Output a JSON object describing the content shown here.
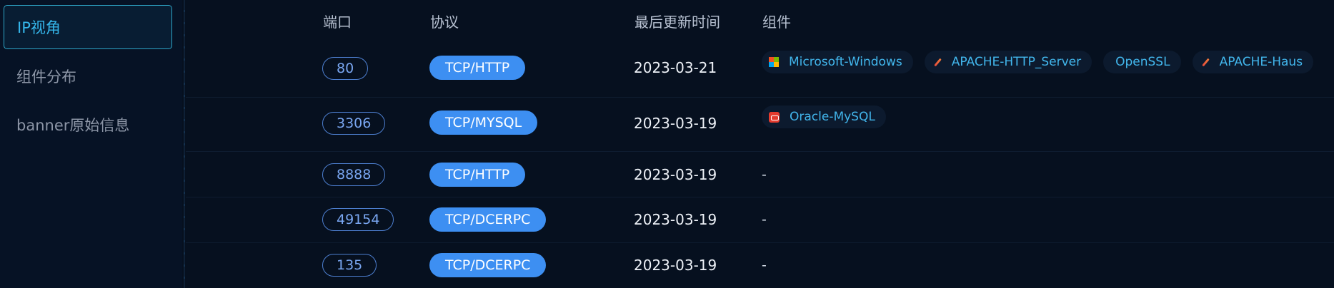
{
  "sidebar": {
    "items": [
      {
        "label": "IP视角",
        "active": true
      },
      {
        "label": "组件分布",
        "active": false
      },
      {
        "label": "banner原始信息",
        "active": false
      }
    ]
  },
  "table": {
    "headers": {
      "port": "端口",
      "protocol": "协议",
      "updated": "最后更新时间",
      "components": "组件"
    },
    "rows": [
      {
        "port": "80",
        "protocol": "TCP/HTTP",
        "updated": "2023-03-21",
        "components": [
          {
            "label": "Microsoft-Windows",
            "icon": "windows-icon"
          },
          {
            "label": "APACHE-HTTP_Server",
            "icon": "apache-feather-icon"
          },
          {
            "label": "OpenSSL",
            "icon": ""
          },
          {
            "label": "APACHE-Haus",
            "icon": "apache-feather-icon"
          }
        ],
        "empty": ""
      },
      {
        "port": "3306",
        "protocol": "TCP/MYSQL",
        "updated": "2023-03-19",
        "components": [
          {
            "label": "Oracle-MySQL",
            "icon": "mysql-icon"
          }
        ],
        "empty": ""
      },
      {
        "port": "8888",
        "protocol": "TCP/HTTP",
        "updated": "2023-03-19",
        "components": [],
        "empty": "-"
      },
      {
        "port": "49154",
        "protocol": "TCP/DCERPC",
        "updated": "2023-03-19",
        "components": [],
        "empty": "-"
      },
      {
        "port": "135",
        "protocol": "TCP/DCERPC",
        "updated": "2023-03-19",
        "components": [],
        "empty": "-"
      }
    ]
  },
  "colors": {
    "background": "#06101f",
    "accent": "#35b6ea",
    "protocol_pill": "#3d8ff2",
    "port_pill_border": "#4d7fd0"
  }
}
